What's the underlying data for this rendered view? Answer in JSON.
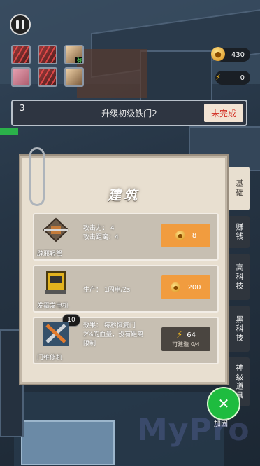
{
  "hud": {
    "coins": "430",
    "energy": "0",
    "avatars": [
      {
        "kind": "enemy",
        "tag": ""
      },
      {
        "kind": "enemy",
        "tag": ""
      },
      {
        "kind": "boy",
        "tag": "弥"
      },
      {
        "kind": "pink",
        "tag": ""
      },
      {
        "kind": "enemy",
        "tag": ""
      },
      {
        "kind": "boy",
        "tag": ""
      }
    ]
  },
  "task": {
    "number": "3",
    "title": "升级初级铁门2",
    "status": "未完成"
  },
  "panel": {
    "title": "建筑",
    "items": [
      {
        "name": "辟邪轻弩",
        "desc1": "攻击力：  4",
        "desc2": "攻击距离：4",
        "price": "8",
        "level": ""
      },
      {
        "name": "发霉发电机",
        "desc1": "生产：    1闪电/2s",
        "desc2": "",
        "price": "200",
        "level": ""
      },
      {
        "name": "门维修机",
        "desc1": "效果：    每秒恢复门",
        "desc2": "2%的血量，没有距离",
        "desc3": "限制",
        "price": "64",
        "buildable": "可建造 0/4",
        "level": "10"
      }
    ]
  },
  "tabs": [
    "基础",
    "赚钱",
    "高科技",
    "黑科技",
    "神级道具"
  ],
  "repair_label": "加固",
  "watermark": "MyPro",
  "colors": {
    "accent": "#f19c3f",
    "status_red": "#d12b1f",
    "green": "#1ebc3f"
  }
}
